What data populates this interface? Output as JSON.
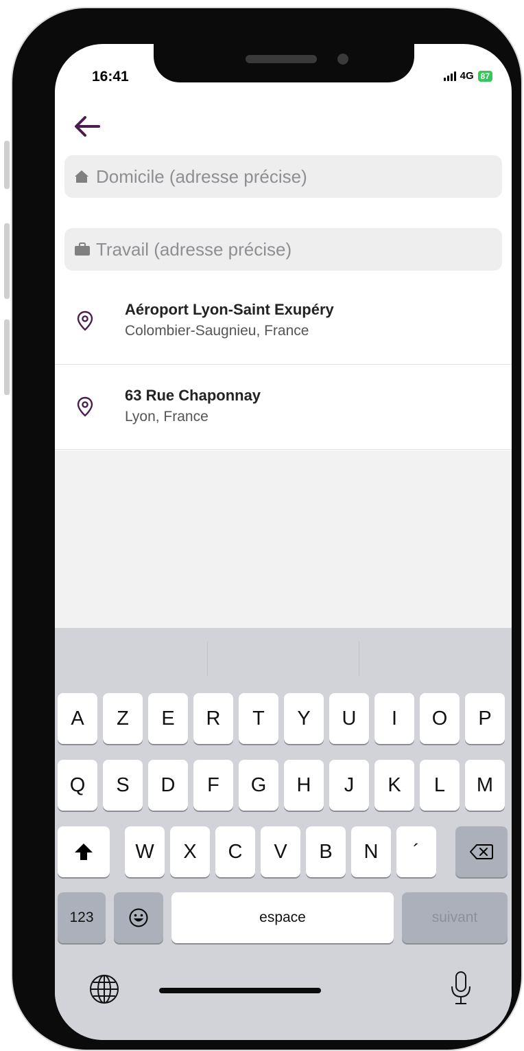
{
  "status_bar": {
    "time": "16:41",
    "network": "4G",
    "battery": "87"
  },
  "header": {
    "back_icon": "arrow-left-icon"
  },
  "fields": {
    "home": {
      "icon": "home-icon",
      "placeholder": "Domicile (adresse précise)"
    },
    "work": {
      "icon": "briefcase-icon",
      "placeholder": "Travail (adresse précise)"
    }
  },
  "suggestions": [
    {
      "icon": "location-pin-icon",
      "title": "Aéroport Lyon-Saint Exupéry",
      "subtitle": "Colombier-Saugnieu, France"
    },
    {
      "icon": "location-pin-icon",
      "title": "63 Rue Chaponnay",
      "subtitle": "Lyon, France"
    }
  ],
  "keyboard": {
    "row1": [
      "A",
      "Z",
      "E",
      "R",
      "T",
      "Y",
      "U",
      "I",
      "O",
      "P"
    ],
    "row2": [
      "Q",
      "S",
      "D",
      "F",
      "G",
      "H",
      "J",
      "K",
      "L",
      "M"
    ],
    "row3": [
      "W",
      "X",
      "C",
      "V",
      "B",
      "N",
      "´"
    ],
    "numbers_key": "123",
    "space_key": "espace",
    "next_key": "suivant",
    "shift_icon": "shift-icon",
    "delete_icon": "delete-icon",
    "emoji_icon": "emoji-icon",
    "globe_icon": "globe-icon",
    "mic_icon": "microphone-icon"
  },
  "colors": {
    "accent": "#4b1d4f",
    "field_bg": "#eeeeef",
    "keyboard_bg": "#d1d3d9",
    "battery": "#35c759"
  }
}
